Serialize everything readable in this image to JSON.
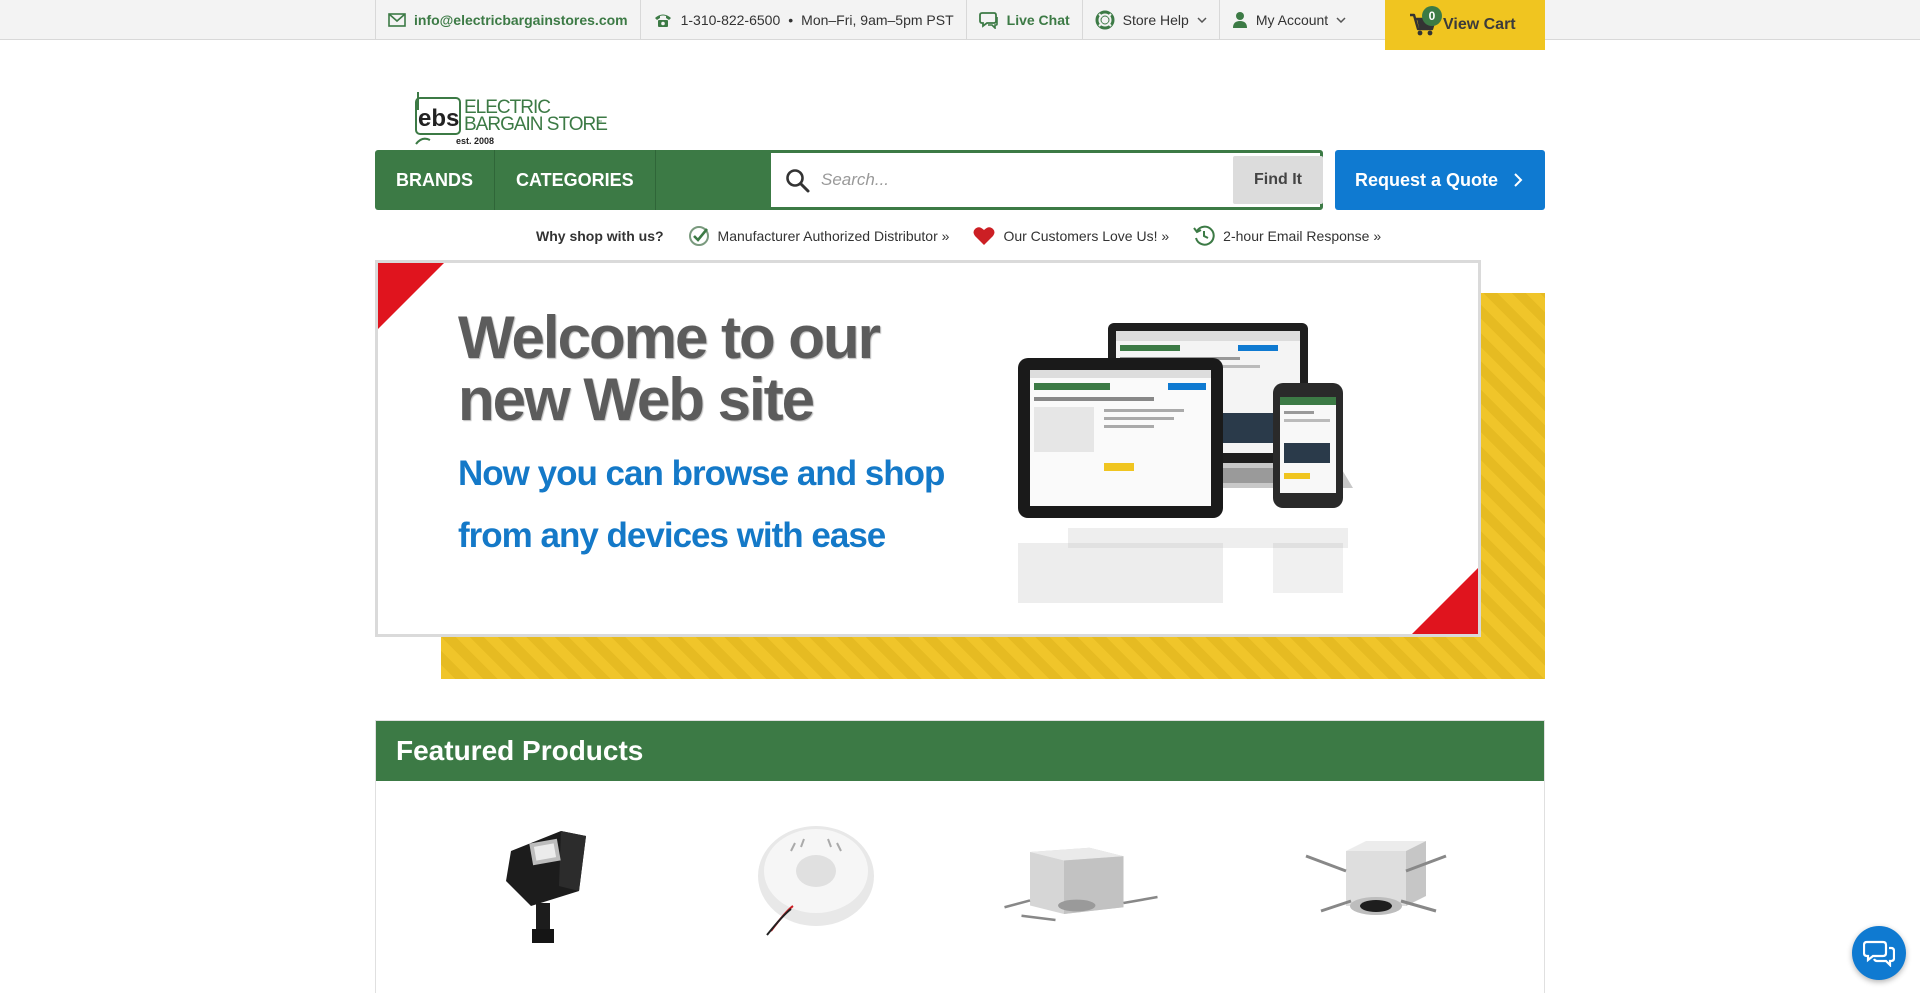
{
  "topbar": {
    "email": "info@electricbargainstores.com",
    "phone": "1-310-822-6500",
    "dot": "•",
    "hours": "Mon–Fri, 9am–5pm PST",
    "live_chat": "Live Chat",
    "store_help": "Store Help",
    "my_account": "My Account",
    "cart_count": "0",
    "cart_label": "View Cart"
  },
  "logo": {
    "mark": "ebs",
    "line1": "ELECTRIC",
    "line2": "BARGAIN STORE",
    "tm": "™",
    "est": "est. 2008"
  },
  "nav": {
    "brands": "BRANDS",
    "categories": "CATEGORIES",
    "search_placeholder": "Search...",
    "find_label": "Find It",
    "quote_label": "Request a Quote"
  },
  "why": {
    "title": "Why shop with us?",
    "items": [
      {
        "label": "Manufacturer Authorized Distributor »",
        "icon": "check-badge-icon"
      },
      {
        "label": "Our Customers Love Us! »",
        "icon": "heart-icon"
      },
      {
        "label": "2-hour Email Response »",
        "icon": "clock-history-icon"
      }
    ]
  },
  "banner": {
    "heading_line1": "Welcome to our",
    "heading_line2": "new Web site",
    "sub_line1": "Now you can browse and shop",
    "sub_line2": "from any devices with ease"
  },
  "featured": {
    "title": "Featured Products",
    "products": [
      {
        "image": "flood-light"
      },
      {
        "image": "smoke-detector"
      },
      {
        "image": "recessed-housing"
      },
      {
        "image": "recessed-light-trim"
      }
    ]
  },
  "colors": {
    "brand_green": "#3c7a45",
    "accent_blue": "#0f7ad1",
    "cart_yellow": "#f0c520",
    "banner_red": "#e0141e"
  }
}
